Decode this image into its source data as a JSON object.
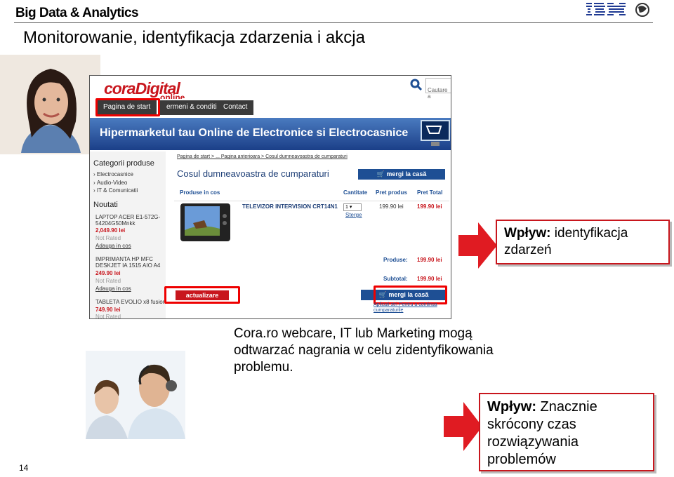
{
  "header": {
    "brand": "Big Data & Analytics",
    "vendor": "IBM",
    "title": "Monitorowanie, identyfikacja zdarzenia i akcja",
    "page_number": "14"
  },
  "site": {
    "logo_main": "coraDigital",
    "logo_sub": "online",
    "search_placeholder": "Cautare a",
    "nav": [
      "Pagina de start",
      "ermeni & conditii",
      "Contact"
    ],
    "banner": "Hipermarketul tau Online de Electronice si Electrocasnice",
    "breadcrumb": "Pagina de start  >  ... Pagina anterioara  >  Cosul dumneavoastra de cumparaturi",
    "cart_title": "Cosul dumneavoastra de cumparaturi",
    "checkout_label": "mergi la casă",
    "update_label": "actualizare",
    "columns": [
      "Produse in cos",
      "Cantitate",
      "Pret produs",
      "Pret Total"
    ],
    "item": {
      "name": "TELEVIZOR INTERVISION CRT14N1",
      "qty": "1",
      "remove": "Sterge",
      "price": "199.90 lei",
      "total": "199.90 lei"
    },
    "produse_label": "Produse:",
    "produse_value": "199.90 lei",
    "subtotal_label": "Subtotal:",
    "subtotal_value": "199.90 lei",
    "footer_link": "Aplicati stri Pentru a continua cumparaturile",
    "sidebar": {
      "cat_title": "Categorii produse",
      "categories": [
        "Electrocasnice",
        "Audio-Video",
        "IT & Comunicatii"
      ],
      "new_title": "Noutati",
      "products": [
        {
          "name": "LAPTOP ACER E1-572G-",
          "name2": "54204G50Mnkk",
          "price": "2,049.90 lei",
          "rating": "Not Rated",
          "link": "Adauga in cos"
        },
        {
          "name": "IMPRIMANTA HP MFC",
          "name2": "DESKJET IA 1515 AIO A4",
          "price": "249.90 lei",
          "rating": "Not Rated",
          "link": "Adauga in cos"
        },
        {
          "name": "TABLETA EVOLIO x8 fusion",
          "name2": "",
          "price": "749.90 lei",
          "rating": "Not Rated",
          "link": ""
        }
      ]
    }
  },
  "impact1": {
    "label": "Wpływ:",
    "text": " identyfikacja zdarzeń"
  },
  "description": "Cora.ro webcare, IT lub Marketing mogą odtwarzać nagrania w celu zidentyfikowania problemu.",
  "impact2": {
    "label": "Wpływ:",
    "text": " Znacznie skrócony czas rozwiązywania problemów"
  },
  "colors": {
    "accent_red": "#c8161d",
    "highlight": "#ff0000",
    "button_blue": "#1e4f94"
  }
}
